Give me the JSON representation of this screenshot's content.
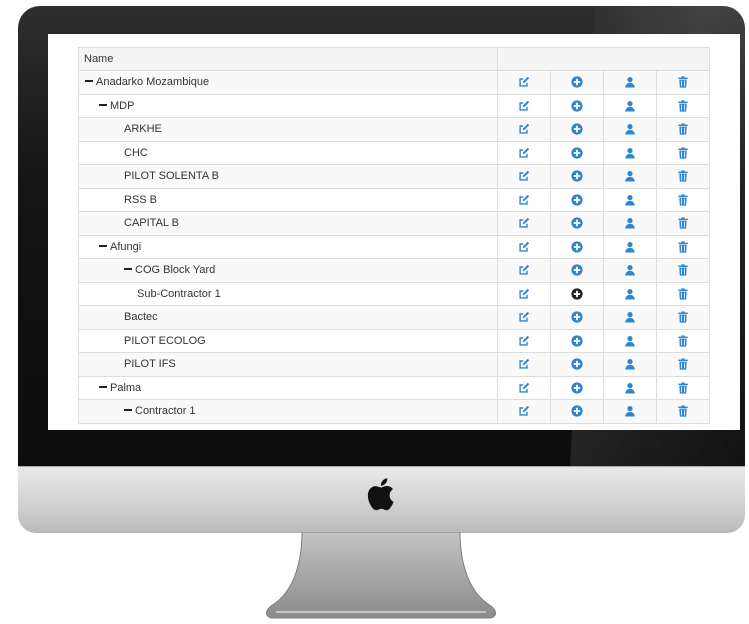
{
  "table": {
    "header": {
      "name": "Name"
    },
    "rows": [
      {
        "label": "Anadarko Mozambique",
        "level": 0,
        "collapsible": true
      },
      {
        "label": "MDP",
        "level": 1,
        "collapsible": true
      },
      {
        "label": "ARKHE",
        "level": 2,
        "collapsible": false
      },
      {
        "label": "CHC",
        "level": 2,
        "collapsible": false
      },
      {
        "label": "PILOT SOLENTA B",
        "level": 2,
        "collapsible": false
      },
      {
        "label": "RSS B",
        "level": 2,
        "collapsible": false
      },
      {
        "label": "CAPITAL B",
        "level": 2,
        "collapsible": false
      },
      {
        "label": "Afungi",
        "level": 1,
        "collapsible": true
      },
      {
        "label": "COG Block Yard",
        "level": 2,
        "collapsible": true
      },
      {
        "label": "Sub-Contractor 1",
        "level": 3,
        "collapsible": false,
        "add_icon_dark": true
      },
      {
        "label": "Bactec",
        "level": 2,
        "collapsible": false
      },
      {
        "label": "PILOT ECOLOG",
        "level": 2,
        "collapsible": false
      },
      {
        "label": "PILOT IFS",
        "level": 2,
        "collapsible": false
      },
      {
        "label": "Palma",
        "level": 1,
        "collapsible": true
      },
      {
        "label": "Contractor 1",
        "level": 2,
        "collapsible": true
      }
    ],
    "actions": [
      {
        "icon": "edit-icon"
      },
      {
        "icon": "add-circle-icon"
      },
      {
        "icon": "user-icon"
      },
      {
        "icon": "trash-icon"
      }
    ]
  },
  "colors": {
    "icon_blue": "#2f86d0",
    "icon_dark": "#222222",
    "monitor_bezel": "#141414"
  }
}
